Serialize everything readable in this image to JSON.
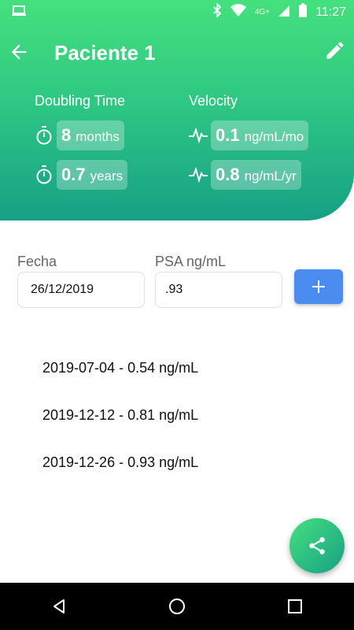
{
  "status_bar": {
    "network": "4G+",
    "time": "11:27"
  },
  "toolbar": {
    "title": "Paciente 1"
  },
  "metrics": {
    "doubling_time": {
      "title": "Doubling Time",
      "rows": [
        {
          "value": "8",
          "unit": "months"
        },
        {
          "value": "0.7",
          "unit": "years"
        }
      ]
    },
    "velocity": {
      "title": "Velocity",
      "rows": [
        {
          "value": "0.1",
          "unit": "ng/mL/mo"
        },
        {
          "value": "0.8",
          "unit": "ng/mL/yr"
        }
      ]
    }
  },
  "form": {
    "fecha_label": "Fecha",
    "fecha_value": "26/12/2019",
    "psa_label": "PSA ng/mL",
    "psa_value": ".93",
    "add_label": "+"
  },
  "records": [
    "2019-07-04 - 0.54 ng/mL",
    "2019-12-12 - 0.81 ng/mL",
    "2019-12-26 - 0.93 ng/mL"
  ],
  "colors": {
    "gradient_top": "#45e07e",
    "gradient_bottom": "#16a085",
    "add_button": "#4a8cf0"
  },
  "icons": {
    "back": "arrow-left-icon",
    "edit": "pencil-icon",
    "timer": "stopwatch-icon",
    "velocity": "pulse-icon",
    "share": "share-icon"
  }
}
